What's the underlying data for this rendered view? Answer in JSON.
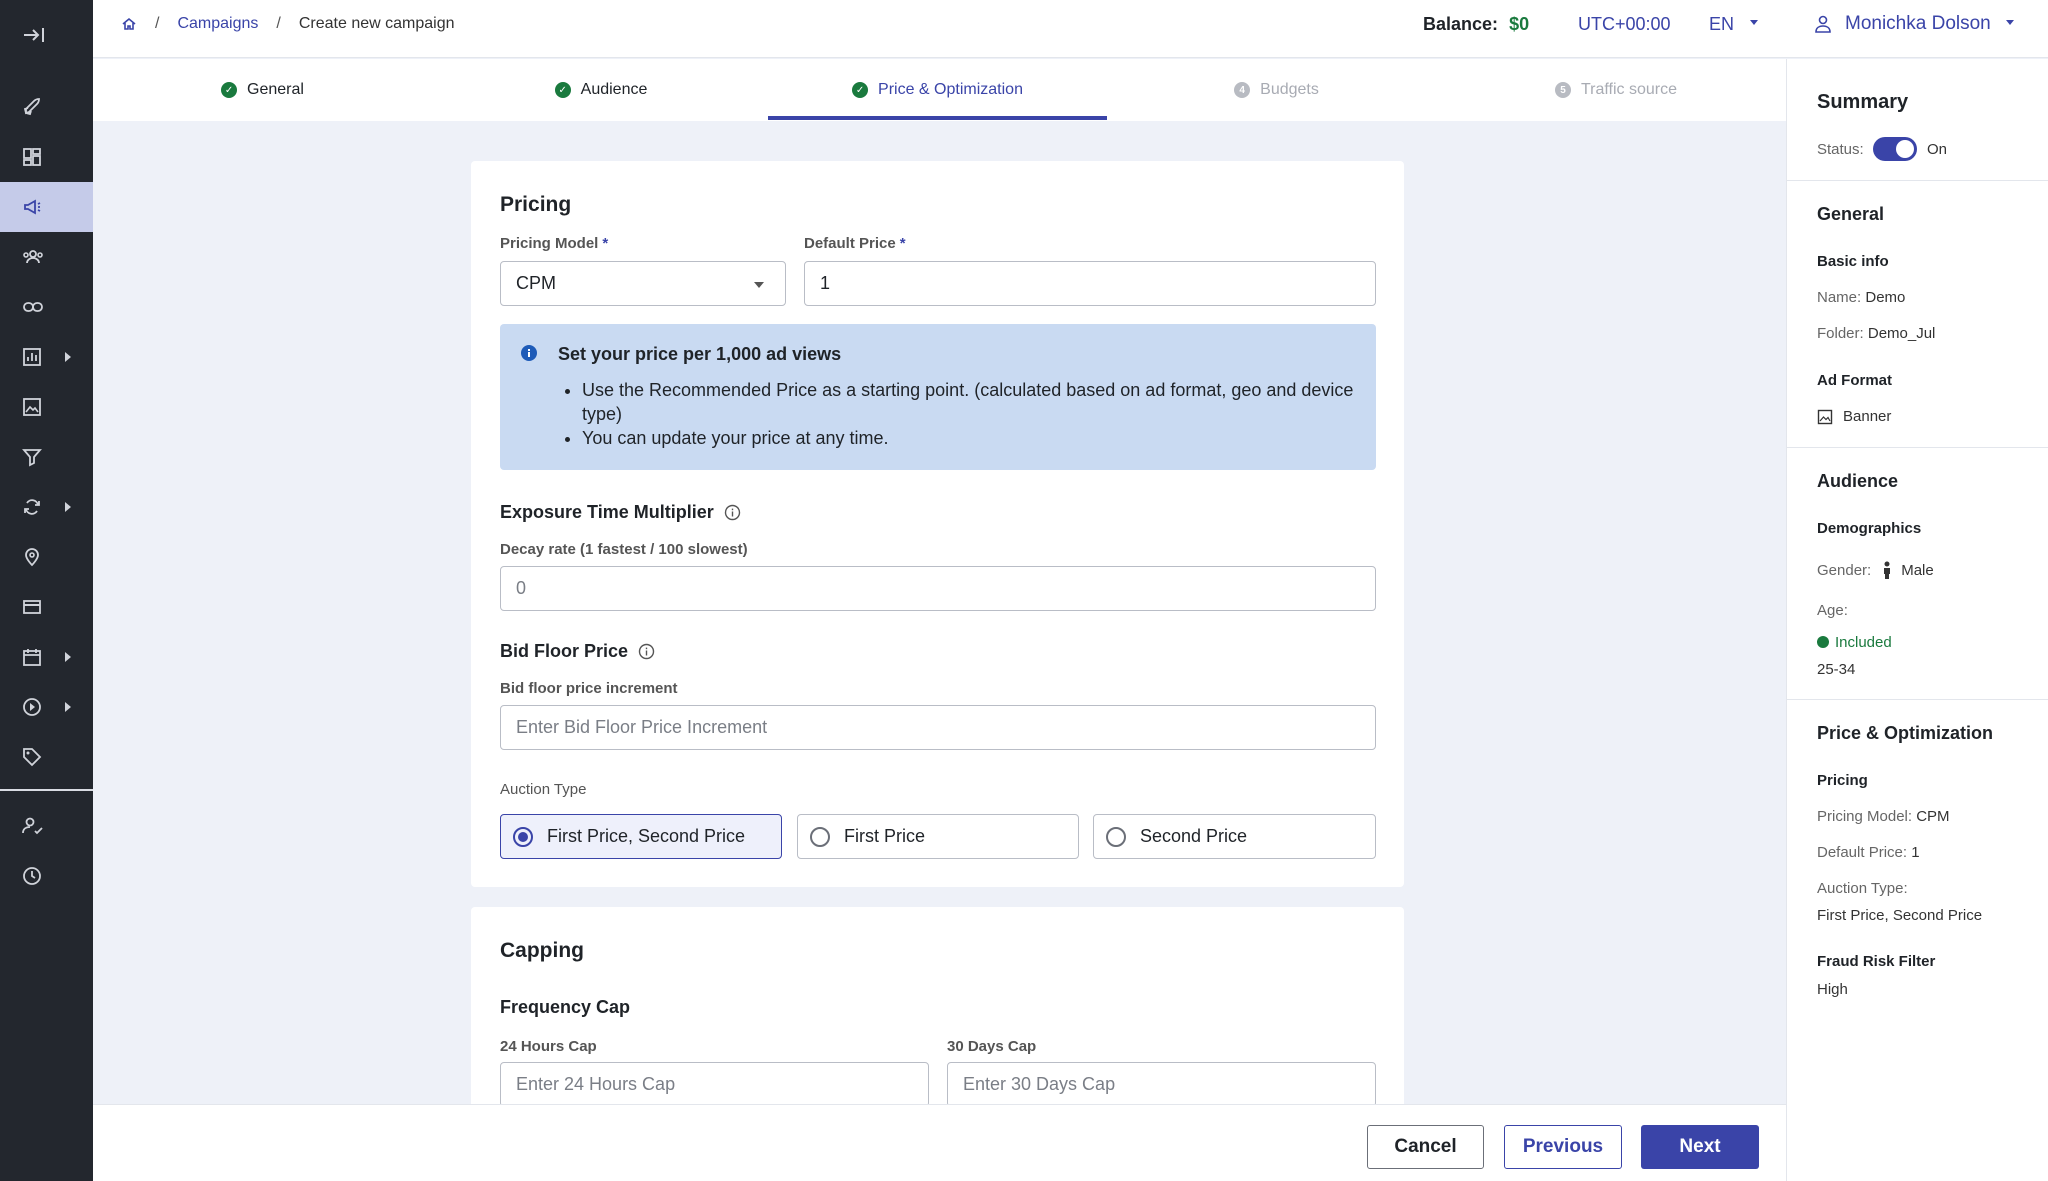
{
  "breadcrumb": {
    "campaigns": "Campaigns",
    "current": "Create new campaign"
  },
  "header": {
    "balance_label": "Balance:",
    "balance_value": "$0",
    "timezone": "UTC+00:00",
    "language": "EN",
    "user_name": "Monichka Dolson"
  },
  "steps": [
    {
      "label": "General",
      "state": "done"
    },
    {
      "label": "Audience",
      "state": "done"
    },
    {
      "label": "Price & Optimization",
      "state": "current"
    },
    {
      "label": "Budgets",
      "state": "todo",
      "number": "4"
    },
    {
      "label": "Traffic source",
      "state": "todo",
      "number": "5"
    }
  ],
  "pricing": {
    "title": "Pricing",
    "model_label": "Pricing Model",
    "model_value": "CPM",
    "default_price_label": "Default Price",
    "default_price_value": "1",
    "required_mark": "*",
    "info_title": "Set your price per 1,000 ad views",
    "info_bullets": [
      "Use the Recommended Price as a starting point. (calculated based on ad format, geo and device type)",
      "You can update your price at any time."
    ],
    "exposure_title": "Exposure Time Multiplier",
    "decay_label": "Decay rate (1 fastest / 100 slowest)",
    "decay_placeholder": "0",
    "bid_floor_title": "Bid Floor Price",
    "bid_floor_label": "Bid floor price increment",
    "bid_floor_placeholder": "Enter Bid Floor Price Increment",
    "auction_label": "Auction Type",
    "auction_options": [
      "First Price, Second Price",
      "First Price",
      "Second Price"
    ],
    "auction_selected": "First Price, Second Price"
  },
  "capping": {
    "title": "Capping",
    "frequency_title": "Frequency Cap",
    "h24_label": "24 Hours Cap",
    "h24_placeholder": "Enter 24 Hours Cap",
    "d30_label": "30 Days Cap",
    "d30_placeholder": "Enter 30 Days Cap"
  },
  "summary": {
    "title": "Summary",
    "status_label": "Status:",
    "status_value": "On",
    "general_title": "General",
    "basic_info": "Basic info",
    "name_label": "Name:",
    "name_value": "Demo",
    "folder_label": "Folder:",
    "folder_value": "Demo_Jul",
    "ad_format_title": "Ad Format",
    "ad_format_value": "Banner",
    "audience_title": "Audience",
    "demographics": "Demographics",
    "gender_label": "Gender:",
    "gender_value": "Male",
    "age_label": "Age:",
    "age_included": "Included",
    "age_value": "25-34",
    "price_title": "Price & Optimization",
    "pricing_sub": "Pricing",
    "pricing_model_label": "Pricing Model:",
    "pricing_model_value": "CPM",
    "default_price_label": "Default Price:",
    "default_price_value": "1",
    "auction_label": "Auction Type:",
    "auction_value": "First Price, Second Price",
    "fraud_title": "Fraud Risk Filter",
    "fraud_value": "High"
  },
  "footer": {
    "cancel": "Cancel",
    "previous": "Previous",
    "next": "Next"
  },
  "colors": {
    "accent": "#3a44a8",
    "success": "#1a7a3e",
    "rail": "#23272e",
    "info_bg": "#c9daf2"
  }
}
